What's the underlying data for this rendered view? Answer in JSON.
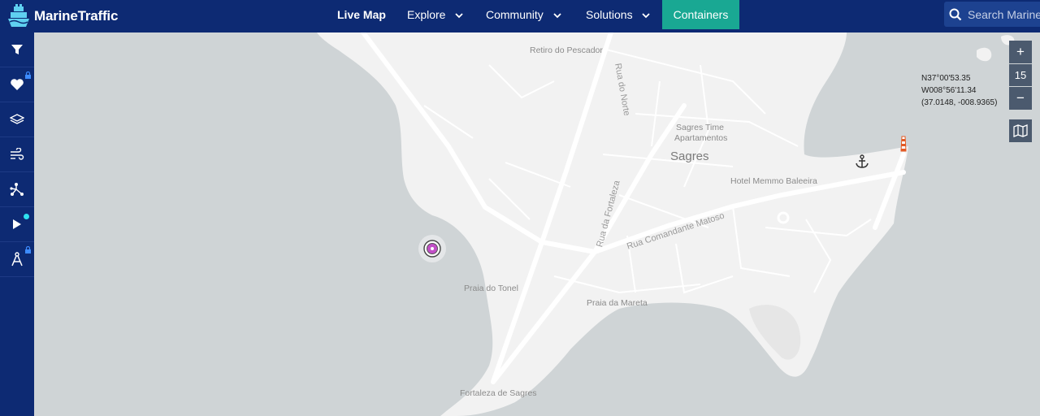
{
  "app": {
    "brand": "MarineTraffic"
  },
  "nav": {
    "live_map": "Live Map",
    "explore": "Explore",
    "community": "Community",
    "solutions": "Solutions",
    "containers": "Containers"
  },
  "search": {
    "placeholder": "Search MarineTraffic"
  },
  "sidebar": {
    "items": [
      {
        "icon": "filter-icon",
        "locked": false
      },
      {
        "icon": "heart-icon",
        "locked": true
      },
      {
        "icon": "layers-icon",
        "locked": false
      },
      {
        "icon": "wind-icon",
        "locked": false
      },
      {
        "icon": "routes-icon",
        "locked": false
      },
      {
        "icon": "play-icon",
        "notification": true
      },
      {
        "icon": "measure-tool-icon",
        "locked": true
      }
    ]
  },
  "map": {
    "zoom_in": "+",
    "zoom_level": "15",
    "zoom_out": "−",
    "coords": {
      "lat": "N37°00'53.35",
      "lon": "W008°56'11.34",
      "decimal": "(37.0148, -008.9365)"
    },
    "labels": {
      "retiro": "Retiro do Pescador",
      "sagres_time": "Sagres Time",
      "apartamentos": "Apartamentos",
      "sagres": "Sagres",
      "hotel": "Hotel Memmo Baleeira",
      "praia_tonel": "Praia do Tonel",
      "praia_mareta": "Praia da Mareta",
      "fortaleza": "Fortaleza de Sagres"
    },
    "streets": {
      "rua_norte": "Rua do Norte",
      "rua_fortaleza": "Rua da Fortaleza",
      "rua_comandante": "Rua Comandante Matoso"
    }
  },
  "colors": {
    "navbar": "#0d2a73",
    "accent": "#19a893",
    "sea": "#cfd4d6",
    "land": "#f2f2f2"
  }
}
